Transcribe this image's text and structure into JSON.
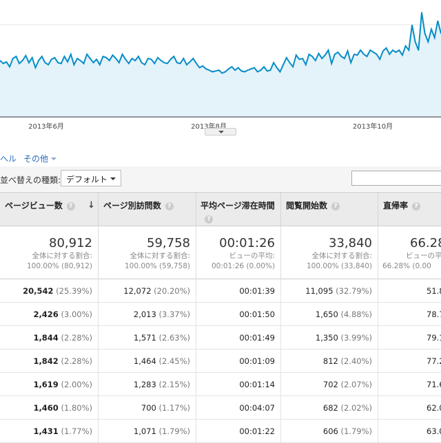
{
  "chart_data": {
    "type": "area",
    "x_ticks": [
      "2013年6月",
      "2013年8月",
      "2013年10月"
    ],
    "values": [
      135,
      128,
      132,
      120,
      140,
      145,
      128,
      135,
      147,
      130,
      142,
      118,
      135,
      145,
      130,
      125,
      138,
      142,
      130,
      128,
      145,
      132,
      150,
      125,
      140,
      135,
      128,
      150,
      140,
      130,
      138,
      125,
      145,
      142,
      135,
      148,
      140,
      130,
      150,
      138,
      128,
      140,
      135,
      145,
      130,
      125,
      140,
      138,
      128,
      142,
      135,
      130,
      128,
      138,
      145,
      130,
      128,
      140,
      125,
      132,
      140,
      128,
      118,
      122,
      115,
      112,
      108,
      110,
      112,
      105,
      108,
      115,
      120,
      112,
      118,
      110,
      108,
      112,
      115,
      118,
      108,
      112,
      120,
      110,
      112,
      130,
      118,
      108,
      125,
      142,
      130,
      120,
      148,
      138,
      140,
      125,
      150,
      145,
      135,
      152,
      140,
      148,
      160,
      128,
      150,
      155,
      145,
      140,
      158,
      130,
      150,
      148,
      160,
      150,
      145,
      160,
      155,
      150,
      138,
      158,
      165,
      150,
      160,
      155,
      160,
      148,
      170,
      160,
      220,
      180,
      160,
      250,
      200,
      180,
      210,
      190,
      230,
      200
    ],
    "ylim": [
      0,
      280
    ],
    "grid": true,
    "color": "#058dc7"
  },
  "nav": {
    "left_label": "ヘル",
    "other_label": "その他"
  },
  "sort": {
    "label": "並べ替えの種類:",
    "value": "デフォルト"
  },
  "headers": [
    {
      "label": "ページビュー数",
      "help": "?",
      "sort": "↓"
    },
    {
      "label": "ページ別訪問数",
      "help": "?"
    },
    {
      "label": "平均ページ滞在時間",
      "help": "?"
    },
    {
      "label": "閲覧開始数",
      "help": "?"
    },
    {
      "label": "直帰率",
      "help": "?"
    }
  ],
  "totals": [
    {
      "value": "80,912",
      "sub1": "全体に対する割合:",
      "sub2": "100.00% (80,912)"
    },
    {
      "value": "59,758",
      "sub1": "全体に対する割合:",
      "sub2": "100.00% (59,758)"
    },
    {
      "value": "00:01:26",
      "sub1": "ビューの平均:",
      "sub2": "00:01:26 (0.00%)"
    },
    {
      "value": "33,840",
      "sub1": "全体に対する割合:",
      "sub2": "100.00% (33,840)"
    },
    {
      "value": "66.28",
      "sub1": "ビューの平",
      "sub2": "66.28% (0.00"
    }
  ],
  "rows": [
    {
      "pv": "20,542",
      "pv_pct": "(25.39%)",
      "upv": "12,072",
      "upv_pct": "(20.20%)",
      "time": "00:01:39",
      "ent": "11,095",
      "ent_pct": "(32.79%)",
      "bounce": "51.8"
    },
    {
      "pv": "2,426",
      "pv_pct": "(3.00%)",
      "upv": "2,013",
      "upv_pct": "(3.37%)",
      "time": "00:01:50",
      "ent": "1,650",
      "ent_pct": "(4.88%)",
      "bounce": "78.7"
    },
    {
      "pv": "1,844",
      "pv_pct": "(2.28%)",
      "upv": "1,571",
      "upv_pct": "(2.63%)",
      "time": "00:01:49",
      "ent": "1,350",
      "ent_pct": "(3.99%)",
      "bounce": "79.1"
    },
    {
      "pv": "1,842",
      "pv_pct": "(2.28%)",
      "upv": "1,464",
      "upv_pct": "(2.45%)",
      "time": "00:01:09",
      "ent": "812",
      "ent_pct": "(2.40%)",
      "bounce": "77.2"
    },
    {
      "pv": "1,619",
      "pv_pct": "(2.00%)",
      "upv": "1,283",
      "upv_pct": "(2.15%)",
      "time": "00:01:14",
      "ent": "702",
      "ent_pct": "(2.07%)",
      "bounce": "71.6"
    },
    {
      "pv": "1,460",
      "pv_pct": "(1.80%)",
      "upv": "700",
      "upv_pct": "(1.17%)",
      "time": "00:04:07",
      "ent": "682",
      "ent_pct": "(2.02%)",
      "bounce": "62.0"
    },
    {
      "pv": "1,431",
      "pv_pct": "(1.77%)",
      "upv": "1,071",
      "upv_pct": "(1.79%)",
      "time": "00:01:22",
      "ent": "606",
      "ent_pct": "(1.79%)",
      "bounce": "63.0"
    }
  ]
}
